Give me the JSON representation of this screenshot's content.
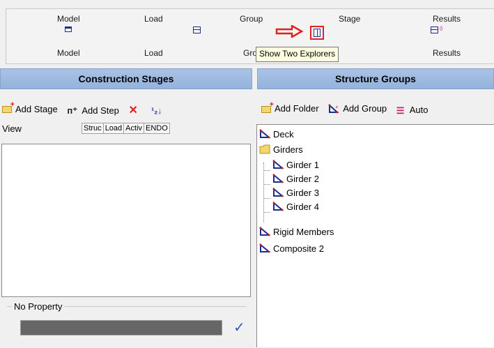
{
  "toolbar": {
    "top_labels": [
      "Model",
      "Load",
      "Group",
      "Stage",
      "Results"
    ],
    "bottom_labels": [
      "Model",
      "Load",
      "Gro",
      "Results"
    ],
    "selected_button_tooltip": "Show Two Explorers"
  },
  "colors": {
    "header_blue": "#a9c3e4",
    "accent_red": "#e02020",
    "icon_blue": "#1c2b8c"
  },
  "left_panel": {
    "title": "Construction Stages",
    "tools": {
      "add_stage": "Add Stage",
      "add_step": "Add Step"
    },
    "view_label": "View",
    "columns": [
      "Struc",
      "Load",
      "Activ",
      "ENDO"
    ],
    "property_group_label": "No Property"
  },
  "right_panel": {
    "title": "Structure Groups",
    "tools": {
      "add_folder": "Add Folder",
      "add_group": "Add Group",
      "auto": "Auto"
    },
    "tree": {
      "deck": "Deck",
      "girders_folder": "Girders",
      "girders": [
        "Girder 1",
        "Girder 2",
        "Girder 3",
        "Girder 4"
      ],
      "rigid": "Rigid Members",
      "composite": "Composite 2"
    }
  }
}
